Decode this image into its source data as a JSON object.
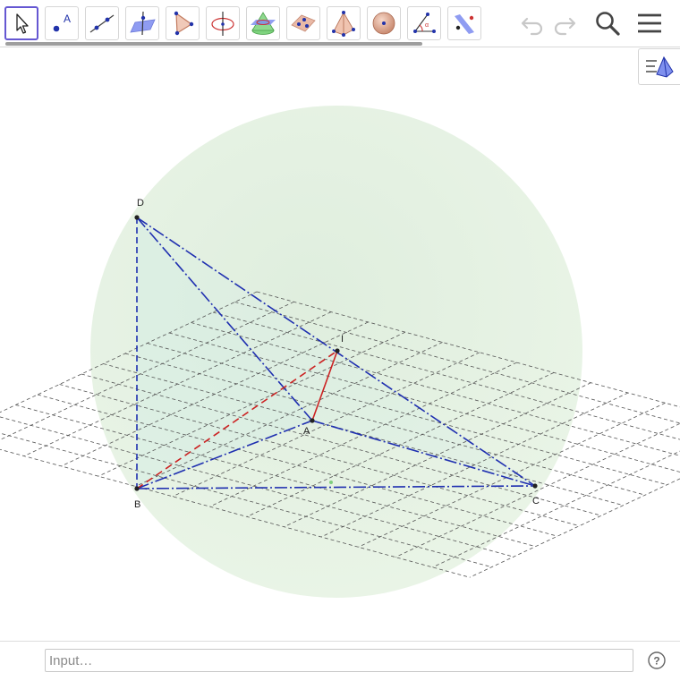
{
  "toolbar": {
    "tools": [
      {
        "name": "move-tool-icon"
      },
      {
        "name": "point-tool-icon"
      },
      {
        "name": "line-tool-icon"
      },
      {
        "name": "perpendicular-line-tool-icon"
      },
      {
        "name": "polygon-tool-icon"
      },
      {
        "name": "circle-axis-tool-icon"
      },
      {
        "name": "intersect-surfaces-tool-icon"
      },
      {
        "name": "plane-tool-icon"
      },
      {
        "name": "pyramid-tool-icon"
      },
      {
        "name": "sphere-tool-icon"
      },
      {
        "name": "angle-tool-icon"
      },
      {
        "name": "reflect-tool-icon"
      }
    ],
    "selected_tool": "move-tool-icon"
  },
  "scene": {
    "points": {
      "D": "D",
      "I": "I",
      "A": "A",
      "B": "B",
      "C": "C"
    },
    "colors": {
      "edge": "#1f2fb0",
      "segment": "#cc2222",
      "grid": "#555555",
      "sphere": "#e3f1de"
    }
  },
  "inputbar": {
    "placeholder": "Input…"
  },
  "colors": {
    "accent": "#6557d2",
    "toolbar_border": "#d6d6d6"
  }
}
